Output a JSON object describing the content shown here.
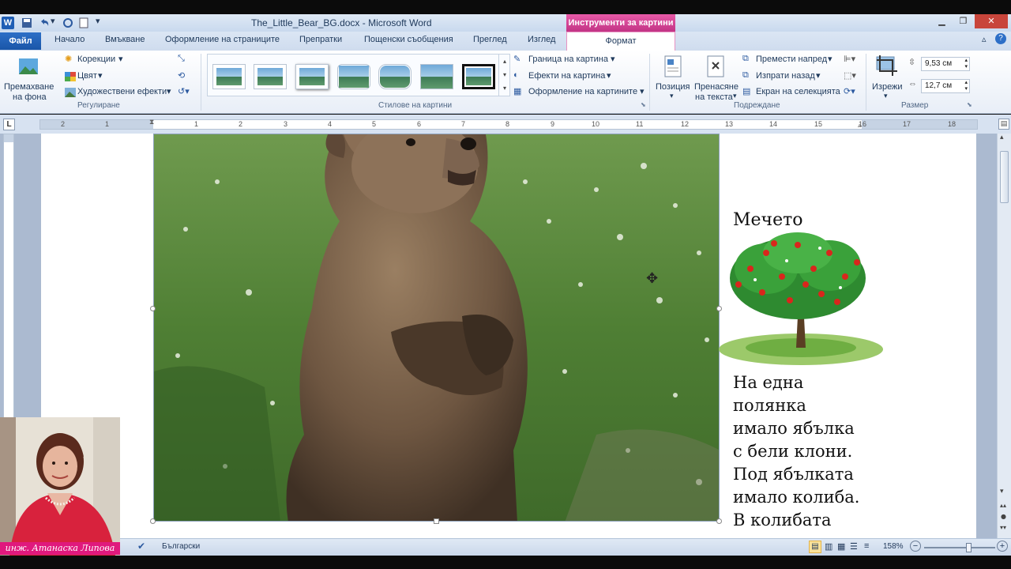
{
  "window": {
    "title": "The_Little_Bear_BG.docx - Microsoft Word",
    "context_tab_title": "Инструменти за картини",
    "app_icon_letter": "W"
  },
  "tabs": {
    "file": "Файл",
    "items": [
      "Начало",
      "Вмъкване",
      "Оформление на страниците",
      "Препратки",
      "Пощенски съобщения",
      "Преглед",
      "Изглед"
    ],
    "active": "Формат"
  },
  "ribbon": {
    "adjust": {
      "remove_bg_line1": "Премахване",
      "remove_bg_line2": "на фона",
      "corrections": "Корекции",
      "color": "Цвят",
      "artistic": "Художествени ефекти",
      "label": "Регулиране"
    },
    "styles": {
      "label": "Стилове на картини",
      "border": "Граница на картина",
      "effects": "Ефекти на картина",
      "layout": "Оформление на картините"
    },
    "arrange": {
      "position": "Позиция",
      "wrap_line1": "Пренасяне",
      "wrap_line2": "на текста",
      "bring_forward": "Премести напред",
      "send_backward": "Изпрати назад",
      "selection_pane": "Екран на селекцията",
      "label": "Подреждане"
    },
    "size": {
      "crop": "Изрежи",
      "height": "9,53 см",
      "width": "12,7 см",
      "label": "Размер"
    }
  },
  "ruler": {
    "numbers": [
      "2",
      "1",
      "1",
      "2",
      "3",
      "4",
      "5",
      "6",
      "7",
      "8",
      "9",
      "10",
      "11",
      "12",
      "13",
      "14",
      "15",
      "16",
      "17",
      "18"
    ],
    "tab_selector": "L"
  },
  "document": {
    "story_title": "Мечето",
    "story_lines": [
      "На една",
      "полянка",
      "имало ябълка",
      "с бели клони.",
      "Под ябълката",
      "имало колиба.",
      "В колибата"
    ]
  },
  "webcam": {
    "caption": "инж. Атанаска Липова"
  },
  "statusbar": {
    "language": "Български",
    "zoom": "158%",
    "zoom_level_fraction": 0.62
  }
}
